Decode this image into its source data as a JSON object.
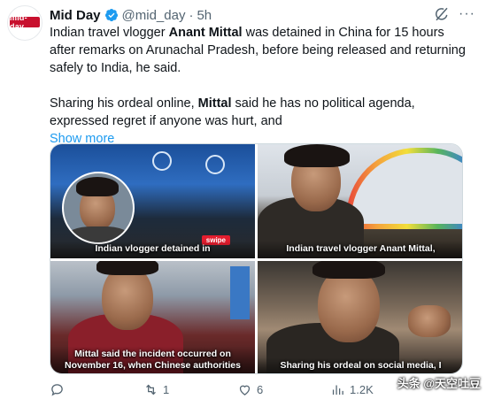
{
  "post": {
    "author_name": "Mid Day",
    "avatar_logo_text": "mid-day",
    "handle": "@mid_day",
    "separator": "·",
    "time": "5h",
    "paragraph1": {
      "pre": "Indian travel vlogger ",
      "bold": "Anant Mittal",
      "post": " was detained in China for 15 hours after remarks on Arunachal Pradesh, before being released and returning safely to India, he said."
    },
    "paragraph2": {
      "pre": "Sharing his ordeal online, ",
      "bold": "Mittal",
      "post": " said he has no political agenda, expressed regret if anyone was hurt, and"
    },
    "show_more": "Show more"
  },
  "media": [
    {
      "caption": "Indian vlogger detained in",
      "badge": "swipe"
    },
    {
      "caption": "Indian travel vlogger Anant Mittal,"
    },
    {
      "caption": "Mittal said the incident occurred on November 16, when Chinese authorities"
    },
    {
      "caption": "Sharing his ordeal on social media, I"
    }
  ],
  "actions": {
    "reply_count": "",
    "repost_count": "1",
    "like_count": "6",
    "views_count": "1.2K"
  },
  "watermark": {
    "text": "头条 @天空吐豆"
  },
  "colors": {
    "accent": "#1d9bf0",
    "muted": "#536471",
    "brand_red": "#c8102e",
    "swipe_red": "#e31d2e"
  },
  "icons": [
    "verified-badge-icon",
    "grok-icon",
    "more-icon",
    "reply-icon",
    "repost-icon",
    "like-icon",
    "views-icon"
  ]
}
